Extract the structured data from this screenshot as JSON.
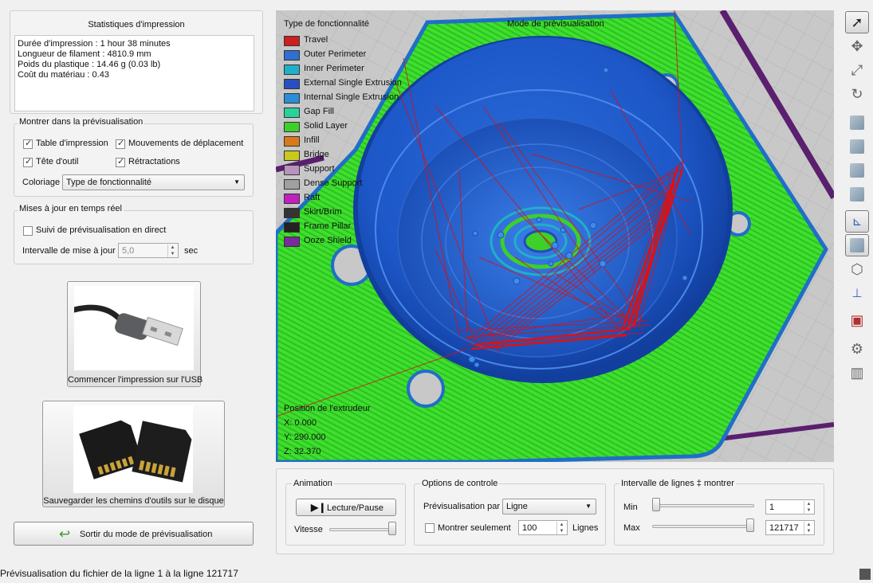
{
  "stats": {
    "title": "Statistiques d'impression",
    "lines": [
      "Durée d'impression : 1 hour 38 minutes",
      "Longueur de filament : 4810.9 mm",
      "Poids du plastique : 14.46 g (0.03 lb)",
      "Coût du matériau : 0.43"
    ]
  },
  "show": {
    "title": "Montrer dans la prévisualisation",
    "bed": "Table d'impression",
    "travel": "Mouvements de déplacement",
    "toolhead": "Tête d'outil",
    "retractions": "Rétractations",
    "coloring_label": "Coloriage",
    "coloring_value": "Type de fonctionnalité"
  },
  "live": {
    "title": "Mises à jour en temps réel",
    "follow": "Suivi de prévisualisation en direct",
    "interval_label": "Intervalle de mise à jour",
    "interval_value": "5,0",
    "interval_unit": "sec"
  },
  "usb_button": {
    "label": "Commencer l'impression sur l'USB"
  },
  "sd_button": {
    "label": "Sauvegarder les chemins d'outils sur le disque"
  },
  "exit_button": {
    "label": "Sortir du mode de prévisualisation"
  },
  "viewport": {
    "legend_title": "Type de fonctionnalité",
    "mode_label": "Mode de prévisualisation",
    "legend": [
      {
        "label": "Travel",
        "color": "#cc2020"
      },
      {
        "label": "Outer Perimeter",
        "color": "#2f6fd0"
      },
      {
        "label": "Inner Perimeter",
        "color": "#1fb0c8"
      },
      {
        "label": "External Single Extrusion",
        "color": "#2a4fc0"
      },
      {
        "label": "Internal Single Extrusion",
        "color": "#2a8fd8"
      },
      {
        "label": "Gap Fill",
        "color": "#2ad29a"
      },
      {
        "label": "Solid Layer",
        "color": "#3ecf2a"
      },
      {
        "label": "Infill",
        "color": "#d87a1a"
      },
      {
        "label": "Bridge",
        "color": "#c8c81e"
      },
      {
        "label": "Support",
        "color": "#b893c0"
      },
      {
        "label": "Dense Support",
        "color": "#a0a0a0"
      },
      {
        "label": "Raft",
        "color": "#c020c0"
      },
      {
        "label": "Skirt/Brim",
        "color": "#333333"
      },
      {
        "label": "Frame Pillar",
        "color": "#222222"
      },
      {
        "label": "Ooze Shield",
        "color": "#7a2a9a"
      }
    ],
    "position_title": "Position de l'extrudeur",
    "x": "X: 0.000",
    "y": "Y: 290.000",
    "z": "Z: 32.370"
  },
  "animation": {
    "title": "Animation",
    "play_label": "Lecture/Pause",
    "speed_label": "Vitesse",
    "speed_level": 1.0
  },
  "control": {
    "title": "Options de controle",
    "preview_by_label": "Prévisualisation par",
    "preview_by_value": "Ligne",
    "show_only_label": "Montrer seulement",
    "show_only_value": "100",
    "show_only_unit": "Lignes"
  },
  "range": {
    "title": "Intervalle de lignes ‡ montrer",
    "min_label": "Min",
    "min_value": "1",
    "max_label": "Max",
    "max_value": "121717",
    "min_level": 0.0,
    "max_level": 1.0
  },
  "status": "Prévisualisation du fichier de la ligne 1 à la ligne 121717"
}
